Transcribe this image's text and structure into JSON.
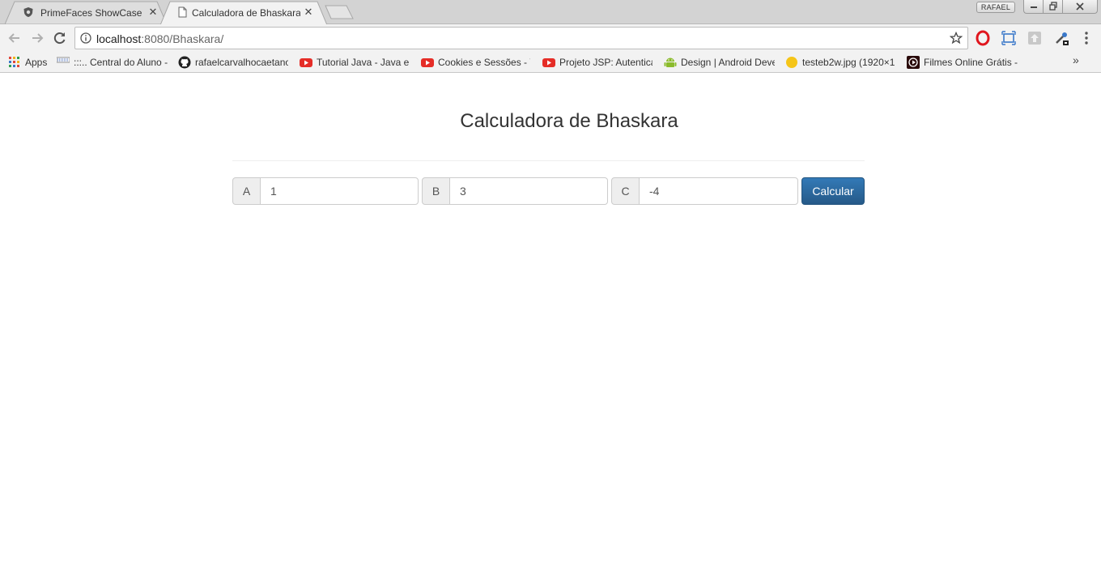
{
  "browser": {
    "tabs": [
      {
        "title": "PrimeFaces ShowCase",
        "favicon": "shield-icon",
        "active": false
      },
      {
        "title": "Calculadora de Bhaskara",
        "favicon": "document-icon",
        "active": true
      }
    ],
    "profile_label": "RAFAEL",
    "address": {
      "host": "localhost",
      "path": ":8080/Bhaskara/"
    },
    "extension_icons": [
      "opera-icon",
      "screenshot-icon",
      "upload-icon",
      "eyedropper-icon",
      "menu-icon"
    ],
    "bookmarks": [
      {
        "label": "Apps",
        "icon": "apps-grid-icon"
      },
      {
        "label": ":::.. Central do Aluno -",
        "icon": "flag-icon"
      },
      {
        "label": "rafaelcarvalhocaetano",
        "icon": "github-icon"
      },
      {
        "label": "Tutorial Java - Java e",
        "icon": "youtube-icon"
      },
      {
        "label": "Cookies e Sessões - Y",
        "icon": "youtube-icon"
      },
      {
        "label": "Projeto JSP: Autentica",
        "icon": "youtube-icon"
      },
      {
        "label": "Design | Android Deve",
        "icon": "android-icon"
      },
      {
        "label": "testeb2w.jpg (1920×1",
        "icon": "image-icon"
      },
      {
        "label": "Filmes Online Grátis -",
        "icon": "play-icon"
      }
    ],
    "more_bookmarks": "»"
  },
  "page": {
    "title": "Calculadora de Bhaskara",
    "fields": {
      "a": {
        "label": "A",
        "value": "1"
      },
      "b": {
        "label": "B",
        "value": "3"
      },
      "c": {
        "label": "C",
        "value": "-4"
      }
    },
    "submit_label": "Calcular"
  },
  "colors": {
    "primary_button": "#337ab7",
    "addon_background": "#eeeeee",
    "border": "#cccccc"
  }
}
